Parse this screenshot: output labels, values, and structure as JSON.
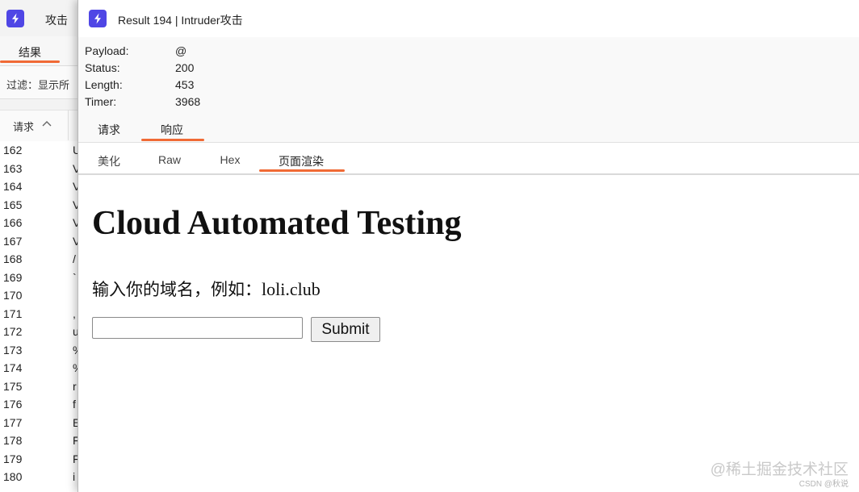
{
  "background_window": {
    "title": "攻击",
    "tab_results": "结果",
    "filter_label": "过滤：显示所",
    "column_header": "请求",
    "rows": [
      {
        "num": "162",
        "cell": "U"
      },
      {
        "num": "163",
        "cell": "V"
      },
      {
        "num": "164",
        "cell": "V"
      },
      {
        "num": "165",
        "cell": "V"
      },
      {
        "num": "166",
        "cell": "V"
      },
      {
        "num": "167",
        "cell": "V"
      },
      {
        "num": "168",
        "cell": "/"
      },
      {
        "num": "169",
        "cell": "`"
      },
      {
        "num": "170",
        "cell": ""
      },
      {
        "num": "171",
        "cell": ","
      },
      {
        "num": "172",
        "cell": "u"
      },
      {
        "num": "173",
        "cell": "%"
      },
      {
        "num": "174",
        "cell": "%"
      },
      {
        "num": "175",
        "cell": "r"
      },
      {
        "num": "176",
        "cell": "f"
      },
      {
        "num": "177",
        "cell": "E"
      },
      {
        "num": "178",
        "cell": "F"
      },
      {
        "num": "179",
        "cell": "F"
      },
      {
        "num": "180",
        "cell": "i"
      }
    ]
  },
  "dialog": {
    "title": "Result 194 | Intruder攻击",
    "meta": {
      "payload_label": "Payload:",
      "payload": "@",
      "status_label": "Status:",
      "status": "200",
      "length_label": "Length:",
      "length": "453",
      "timer_label": "Timer:",
      "timer": "3968"
    },
    "tabs": {
      "request": "请求",
      "response": "响应",
      "active": "响应"
    },
    "subtabs": {
      "beautify": "美化",
      "raw": "Raw",
      "hex": "Hex",
      "render": "页面渲染",
      "active": "页面渲染"
    }
  },
  "rendered_page": {
    "heading": "Cloud Automated Testing",
    "prompt_zh": "输入你的域名，例如：",
    "prompt_example": "loli.club",
    "input_value": "",
    "submit_label": "Submit"
  },
  "watermark": {
    "main": "@稀土掘金技术社区",
    "sub": "CSDN @秋说"
  },
  "colors": {
    "accent": "#f06a35",
    "app_icon": "#4f46e5"
  },
  "icons": {
    "app": "lightning-bolt-icon",
    "sort": "chevron-up-icon"
  }
}
